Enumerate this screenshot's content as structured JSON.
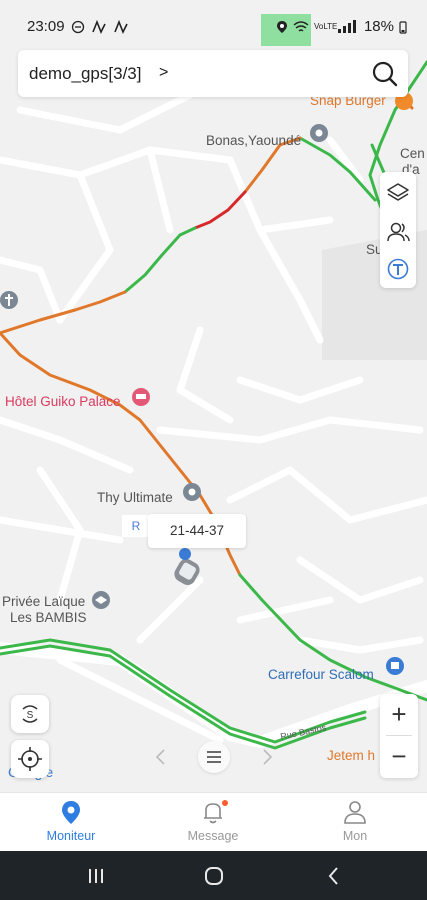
{
  "status_bar": {
    "time": "23:09",
    "net_badge": "VoLTE",
    "battery": "18%"
  },
  "header": {
    "title": "demo_gps[3/3]",
    "chevron": ">"
  },
  "map": {
    "labels": {
      "snap_burger": "Snap Burger",
      "bonas": "Bonas,Yaoundé",
      "centre_partial": "Cen",
      "centre_partial2": "d'a",
      "su_partial": "Su",
      "hotel": "Hôtel Guiko Palace",
      "thy_ultimate": "Thy Ultimate",
      "privee_1": "Privée Laïque",
      "privee_2": "Les BAMBIS",
      "carrefour": "Carrefour Scalom",
      "jetem": "Jetem h",
      "google": "Google",
      "road_name": "Rue Bastos"
    },
    "time_tag": "21-44-37",
    "r_tag": "R",
    "route_colors": {
      "green": "#3cb84a",
      "orange": "#e0782b",
      "red": "#d62a2a"
    }
  },
  "zoom": {
    "in": "+",
    "out": "−"
  },
  "tabs": [
    {
      "label": "Moniteur",
      "active": true
    },
    {
      "label": "Message",
      "active": false
    },
    {
      "label": "Mon",
      "active": false
    }
  ],
  "colors": {
    "accent": "#2f7de1",
    "inactive": "#999999"
  }
}
